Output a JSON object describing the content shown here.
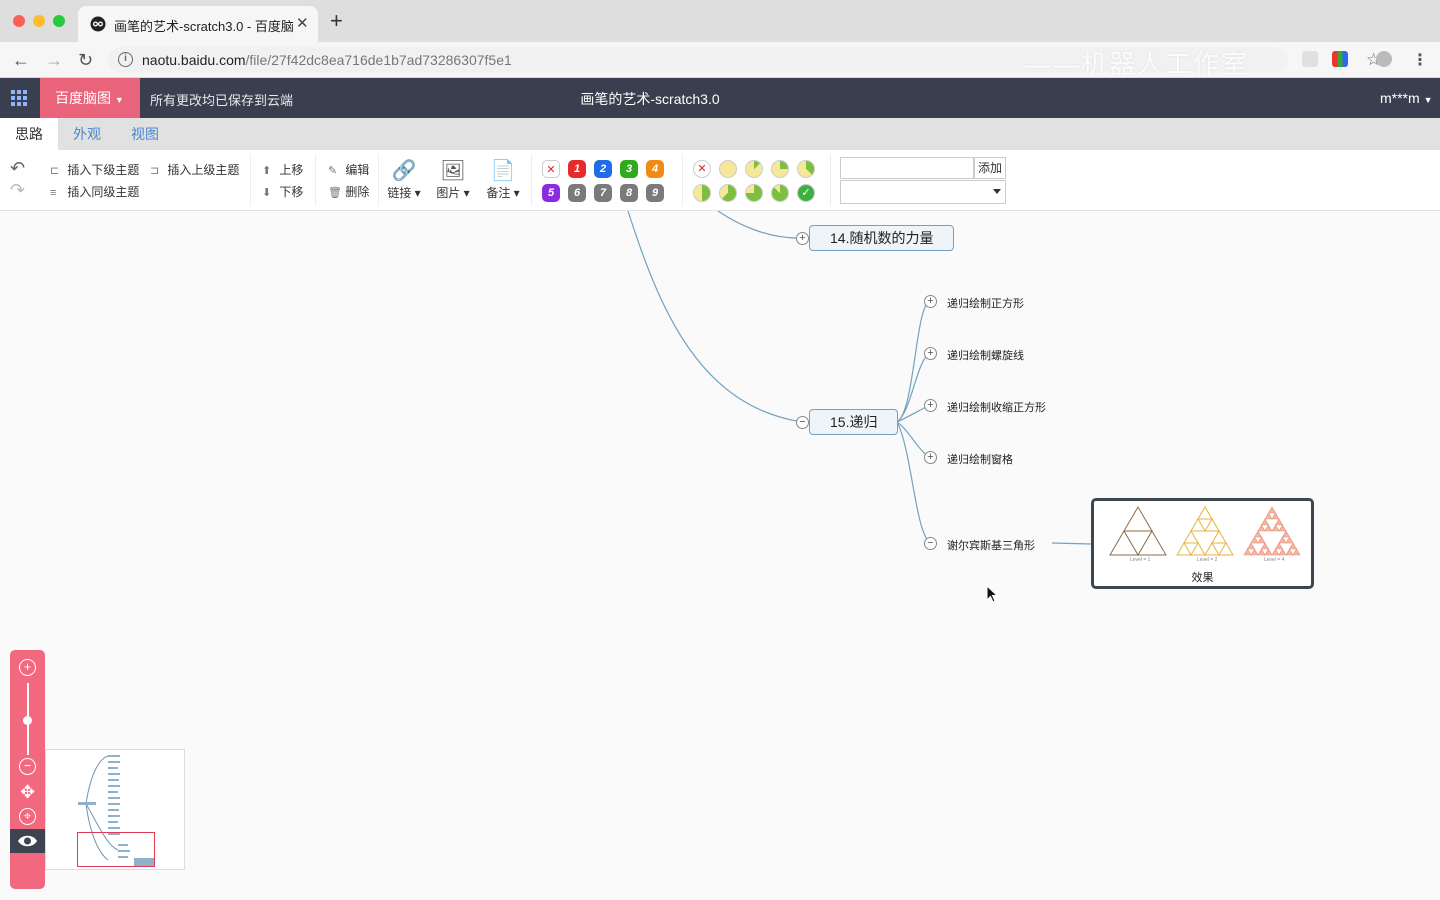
{
  "browser": {
    "tab_title": "画笔的艺术-scratch3.0 - 百度脑图",
    "url_host": "naotu.baidu.com",
    "url_path": "/file/27f42dc8ea716de1b7ad73286307f5e1",
    "watermark": "——机器人工作室"
  },
  "app": {
    "brand": "百度脑图",
    "save_status": "所有更改均已保存到云端",
    "doc_title": "画笔的艺术-scratch3.0",
    "user": "m***m"
  },
  "menu_tabs": [
    "思路",
    "外观",
    "视图"
  ],
  "toolbar": {
    "insert_child": "插入下级主题",
    "insert_parent": "插入上级主题",
    "insert_sibling": "插入同级主题",
    "move_up": "上移",
    "move_down": "下移",
    "edit": "编辑",
    "delete": "删除",
    "link": "链接",
    "image": "图片",
    "note": "备注",
    "priorities": [
      "1",
      "2",
      "3",
      "4",
      "5",
      "6",
      "7",
      "8",
      "9"
    ],
    "priority_colors": [
      "#e52b2b",
      "#1e6ce6",
      "#2faa1e",
      "#f08a15",
      "#8a2be2",
      "#7a7a7a",
      "#7a7a7a",
      "#7a7a7a",
      "#7a7a7a"
    ],
    "resource_add": "添加"
  },
  "mindmap": {
    "node_14": "14.随机数的力量",
    "node_15": "15.递归",
    "children": [
      "递归绘制正方形",
      "递归绘制螺旋线",
      "递归绘制收缩正方形",
      "递归绘制窗格",
      "谢尔宾斯基三角形"
    ],
    "image_caption": "效果",
    "triangle_labels": [
      "Level = 1",
      "Level = 2",
      "Level = 4"
    ]
  },
  "colors": {
    "accent": "#e9637b",
    "header": "#393f4f",
    "link_blue": "#4b86d0",
    "connector": "#73a1bf"
  }
}
